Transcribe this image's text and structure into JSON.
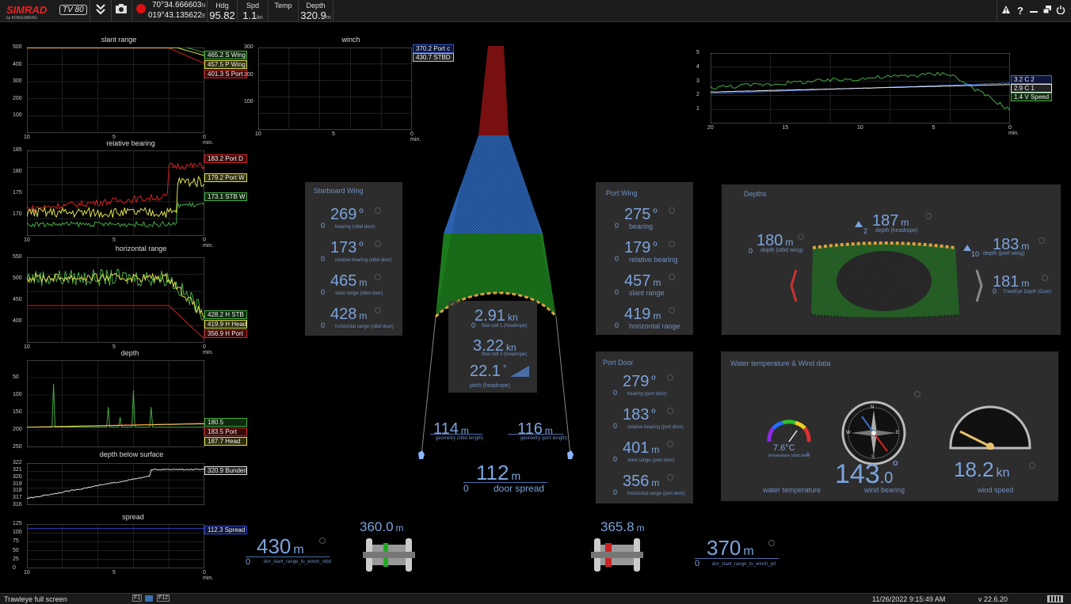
{
  "topbar": {
    "brand": "SIMRAD",
    "brand_sub": "by KONGSBERG",
    "tv_badge": "TV 80",
    "lat": "70°34.666603",
    "lat_hemi": "N",
    "lon": "019°43.135622",
    "lon_hemi": "E",
    "hdg_label": "Hdg",
    "hdg_value": "95.82",
    "spd_label": "Spd",
    "spd_value": "1.1",
    "spd_unit": "kn",
    "temp_label": "Temp",
    "depth_label": "Depth",
    "depth_value": "320.9",
    "depth_unit": "m",
    "right_icons": [
      "warning-icon",
      "help-icon",
      "minimize-icon",
      "restore-icon",
      "power-icon"
    ]
  },
  "charts": {
    "slant": {
      "title": "slant range",
      "yticks": [
        "500",
        "400",
        "300",
        "200",
        "100"
      ],
      "xticks": [
        "10",
        "5",
        "0 min."
      ],
      "legend": [
        {
          "text": "465.2 S Wing",
          "color": "#44aa44"
        },
        {
          "text": "457.5 P Wing",
          "color": "#e0e050"
        },
        {
          "text": "401.3 S Port",
          "color": "#cc2222"
        }
      ]
    },
    "bearing": {
      "title": "relative bearing",
      "yticks": [
        "185",
        "180",
        "175",
        "170"
      ],
      "xticks": [
        "10",
        "5",
        "0 min."
      ],
      "legend": [
        {
          "text": "183.2 Port D",
          "color": "#cc2222"
        },
        {
          "text": "179.2 Port W",
          "color": "#e0e050"
        },
        {
          "text": "173.1 STB W",
          "color": "#44aa44"
        }
      ]
    },
    "horizontal": {
      "title": "horizontal range",
      "yticks": [
        "550",
        "500",
        "450",
        "400"
      ],
      "xticks": [
        "10",
        "5",
        "0 min."
      ],
      "legend": [
        {
          "text": "428.2 H STB",
          "color": "#44aa44"
        },
        {
          "text": "419.9 H Head",
          "color": "#e0e050"
        },
        {
          "text": "356.9 H Port",
          "color": "#cc2222"
        }
      ]
    },
    "depth": {
      "title": "depth",
      "yticks": [
        "50",
        "100",
        "150",
        "200",
        "250"
      ],
      "xticks": [],
      "legend": [
        {
          "text": "180.5",
          "color": "#44aa44"
        },
        {
          "text": "183.5 Port",
          "color": "#cc2222"
        },
        {
          "text": "187.7 Head",
          "color": "#e0e050"
        }
      ]
    },
    "surface": {
      "title": "depth below surface",
      "yticks": [
        "322",
        "321",
        "320",
        "319",
        "318",
        "317",
        "316"
      ],
      "xticks": [],
      "legend": [
        {
          "text": "320.9 Bunden",
          "color": "#dddddd"
        }
      ]
    },
    "spread": {
      "title": "spread",
      "yticks": [
        "125",
        "100",
        "75",
        "50",
        "25",
        "0"
      ],
      "xticks": [
        "10",
        "5",
        "0 min."
      ],
      "legend": [
        {
          "text": "112.3 Spread",
          "color": "#3344cc"
        }
      ]
    },
    "winch": {
      "title": "winch",
      "yticks": [
        "300",
        "200",
        "100"
      ],
      "xticks": [
        "10",
        "5",
        "0 min."
      ],
      "legend": [
        {
          "text": "370.2 Port c",
          "color": "#3355cc"
        },
        {
          "text": "430.7 STBD",
          "color": "#bbbbbb"
        }
      ]
    },
    "topright": {
      "yticks": [
        "5",
        "4",
        "3",
        "2",
        "1"
      ],
      "xticks": [
        "20",
        "15",
        "10",
        "5",
        "0 min."
      ],
      "legend": [
        {
          "text": "3.2 C 2",
          "color": "#3366dd"
        },
        {
          "text": "2.9 C 1",
          "color": "#eeeeee"
        },
        {
          "text": "1.4 V Speed",
          "color": "#44aa44"
        }
      ]
    }
  },
  "starboard_wing": {
    "title": "Starboard Wing",
    "rows": [
      {
        "zero": "0",
        "value": "269",
        "unit": "º",
        "label": "bearing (stbd door)"
      },
      {
        "zero": "0",
        "value": "173",
        "unit": "º",
        "label": "relative bearing (stbd door)"
      },
      {
        "zero": "0",
        "value": "465",
        "unit": "m",
        "label": "slant range (stbd door)"
      },
      {
        "zero": "0",
        "value": "428",
        "unit": "m",
        "label": "horizontal range (stbd door)"
      }
    ]
  },
  "port_wing": {
    "title": "Port Wing",
    "rows": [
      {
        "zero": "0",
        "value": "275",
        "unit": "º",
        "label": "bearing"
      },
      {
        "zero": "0",
        "value": "179",
        "unit": "º",
        "label": "relative bearing"
      },
      {
        "zero": "0",
        "value": "457",
        "unit": "m",
        "label": "slant range"
      },
      {
        "zero": "0",
        "value": "419",
        "unit": "m",
        "label": "horizontal range"
      }
    ]
  },
  "port_door": {
    "title": "Port Door",
    "rows": [
      {
        "zero": "0",
        "value": "279",
        "unit": "º",
        "label": "bearing (port door)"
      },
      {
        "zero": "0",
        "value": "183",
        "unit": "º",
        "label": "relative bearing (port door)"
      },
      {
        "zero": "0",
        "value": "401",
        "unit": "m",
        "label": "slant range (port door)"
      },
      {
        "zero": "0",
        "value": "356",
        "unit": "m",
        "label": "horizontal range (port door)"
      }
    ]
  },
  "headrope": {
    "flow1_value": "2.91",
    "flow1_unit": "kn",
    "flow1_zero": "0",
    "flow1_label": "flow cell 1 (headrope)",
    "flow2_value": "3.22",
    "flow2_unit": "kn",
    "flow2_zero": "0",
    "flow2_label": "flow cell 2 (headrope)",
    "pitch_value": "22.1",
    "pitch_unit": "°",
    "pitch_label": "pitch (headrope)"
  },
  "geometry": {
    "stbd_value": "114",
    "stbd_unit": "m",
    "stbd_label": "geometry (stbd length)",
    "port_value": "116",
    "port_unit": "m",
    "port_label": "geometry (port length)",
    "spread_value": "112",
    "spread_unit": "m",
    "spread_zero": "0",
    "spread_label": "door spread"
  },
  "depths": {
    "title": "Depths",
    "head_value": "187",
    "head_unit": "m",
    "head_zero": "2",
    "head_label": "depth (headrope)",
    "stbd_value": "180",
    "stbd_unit": "m",
    "stbd_zero": "0",
    "stbd_label": "depth (stbd wing)",
    "port_value": "183",
    "port_unit": "m",
    "port_zero": "10",
    "port_label": "depth (port wing)",
    "door_value": "181",
    "door_unit": "m",
    "door_zero": "0",
    "door_label": "TrawlEye Depth (Door)"
  },
  "weather": {
    "title": "Water temperature & Wind data",
    "temp_value": "7.6",
    "temp_unit": "°C",
    "temp_sub": "temperature (stbd door)",
    "temp_zero": "0",
    "temp_label": "water temperature",
    "bearing_value": "143",
    "bearing_dec": ".0",
    "bearing_unit": "º",
    "bearing_label": "wind bearing",
    "speed_value": "18.2",
    "speed_unit": "kn",
    "speed_label": "wind speed",
    "compass_letters": [
      "N",
      "E",
      "S",
      "W"
    ],
    "dial_ticks": [
      "0",
      "10",
      "20",
      "30",
      "40",
      "50",
      "60",
      "70",
      "80",
      "90",
      "100"
    ]
  },
  "winches": {
    "stbd_value": "360.0",
    "stbd_unit": "m",
    "port_value": "365.8",
    "port_unit": "m",
    "stbd_range_value": "430",
    "stbd_range_unit": "m",
    "stbd_range_zero": "0",
    "stbd_range_label": "dor_slant_range_to_winch_stbd",
    "port_range_value": "370",
    "port_range_unit": "m",
    "port_range_zero": "0",
    "port_range_label": "dor_slant_range_to_winch_prt"
  },
  "statusbar": {
    "title": "Trawleye full screen",
    "f1": "F1",
    "f12": "F12",
    "datetime": "11/26/2022 9:15:49 AM",
    "version": "v 22.6.20"
  },
  "colors": {
    "accent": "#7da3dc",
    "panel": "#2d2d2d",
    "red": "#cc2222",
    "green": "#44aa44",
    "yellow": "#e0e050"
  }
}
